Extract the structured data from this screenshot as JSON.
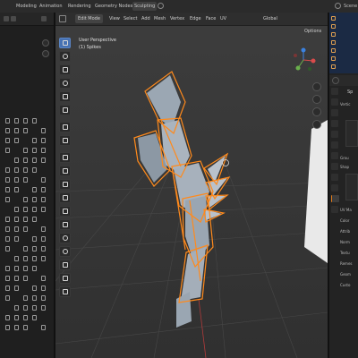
{
  "workspace_tabs": [
    "Modeling",
    "Animation",
    "Rendering",
    "Geometry Nodes",
    "Sculpting"
  ],
  "active_workspace": "Sculpting",
  "scene_name": "Scene",
  "viewport": {
    "mode": "Edit Mode",
    "menu": [
      "View",
      "Select",
      "Add",
      "Mesh",
      "Vertex",
      "Edge",
      "Face",
      "UV"
    ],
    "perspective_label": "User Perspective",
    "object_label": "(1) Spikes",
    "orientation": "Global",
    "options": "Options"
  },
  "properties": {
    "title": "Sp",
    "rows": [
      "Vertic",
      "Grou",
      "Shap",
      "UV Ma",
      "Color",
      "Attrib",
      "Norm",
      "Textu",
      "Remes",
      "Geom",
      "Custo"
    ]
  },
  "colors": {
    "accent": "#e07a1a",
    "selection": "#ff8a1c",
    "tool_active": "#4772b3",
    "outliner_bg": "#1b2a44"
  }
}
